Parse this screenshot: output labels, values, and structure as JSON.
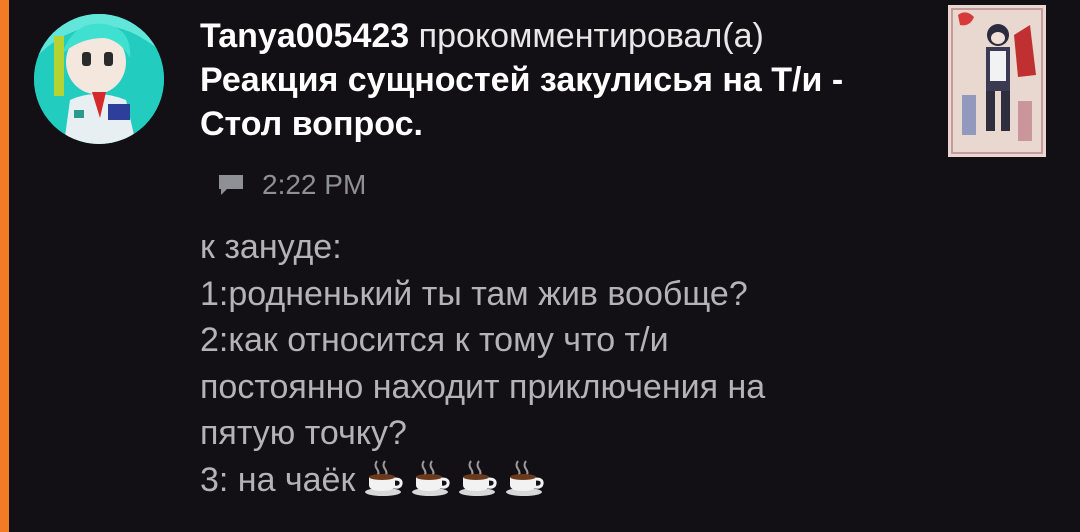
{
  "notification": {
    "username": "Tanya005423",
    "action": "прокомментировал(а)",
    "post_title": "Реакция сущностей закулисья на Т/и - Стол вопрос.",
    "time": "2:22 PM",
    "comment_icon": "speech-bubble-icon",
    "comment_lines": [
      "к зануде:",
      "1:родненький ты там жив вообще?",
      "2:как относится к тому что т/и",
      "постоянно находит приключения на",
      "пятую точку?",
      "3: на чаёк"
    ],
    "emoji": [
      "hot-beverage",
      "hot-beverage",
      "hot-beverage",
      "hot-beverage"
    ]
  },
  "colors": {
    "background": "#121014",
    "accent": "#f47b26",
    "text_primary": "#ffffff",
    "text_secondary": "#b3b3b8",
    "meta": "#8f8f96"
  }
}
